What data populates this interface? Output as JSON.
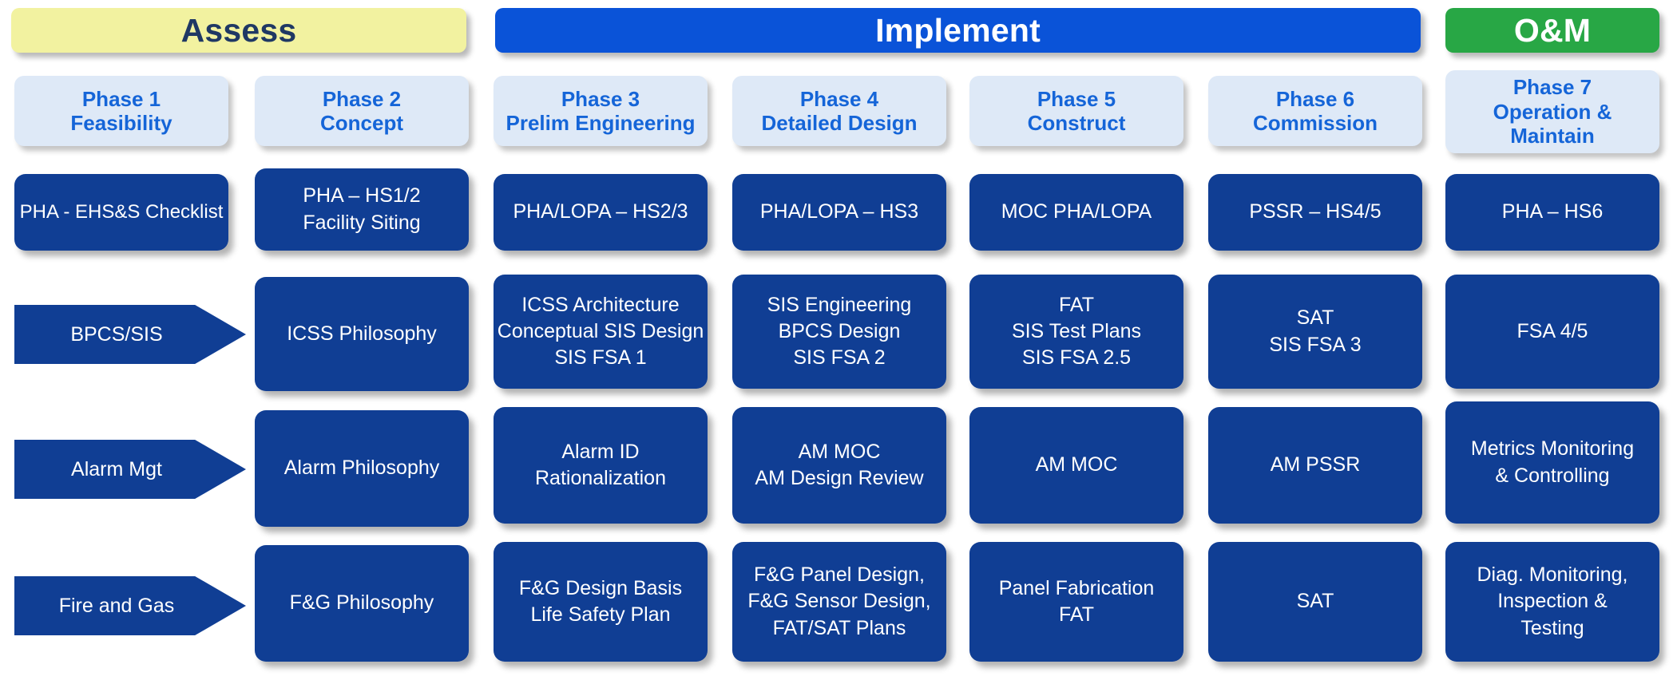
{
  "colors": {
    "assess_banner_bg": "#F2F2A0",
    "assess_banner_text": "#1F3864",
    "implement_banner_bg": "#0A53D8",
    "om_banner_bg": "#28A745",
    "phase_box_bg": "#DEE9F7",
    "phase_box_text": "#1565D8",
    "cell_bg": "#103E94",
    "cell_text": "#FFFFFF"
  },
  "banners": [
    {
      "label": "Assess",
      "id": "assess"
    },
    {
      "label": "Implement",
      "id": "implement"
    },
    {
      "label": "O&M",
      "id": "om"
    }
  ],
  "phases": [
    {
      "number": "Phase 1",
      "name_lines": [
        "Feasibility"
      ]
    },
    {
      "number": "Phase 2",
      "name_lines": [
        "Concept"
      ]
    },
    {
      "number": "Phase 3",
      "name_lines": [
        "Prelim Engineering"
      ]
    },
    {
      "number": "Phase 4",
      "name_lines": [
        "Detailed Design"
      ]
    },
    {
      "number": "Phase 5",
      "name_lines": [
        "Construct"
      ]
    },
    {
      "number": "Phase 6",
      "name_lines": [
        "Commission"
      ]
    },
    {
      "number": "Phase 7",
      "name_lines": [
        "Operation &",
        "Maintain"
      ]
    }
  ],
  "rows": [
    {
      "track_label": "",
      "track_shape": "box",
      "cells": [
        {
          "lines": [
            "PHA - EHS&S Checklist"
          ]
        },
        {
          "lines": [
            "PHA – HS1/2",
            "Facility Siting"
          ]
        },
        {
          "lines": [
            "PHA/LOPA – HS2/3"
          ]
        },
        {
          "lines": [
            "PHA/LOPA – HS3"
          ]
        },
        {
          "lines": [
            "MOC PHA/LOPA"
          ]
        },
        {
          "lines": [
            "PSSR – HS4/5"
          ]
        },
        {
          "lines": [
            "PHA – HS6"
          ]
        }
      ]
    },
    {
      "track_label": "BPCS/SIS",
      "track_shape": "chevron",
      "cells": [
        {
          "lines": [
            "ICSS Philosophy"
          ]
        },
        {
          "lines": [
            "ICSS Architecture",
            "Conceptual SIS Design",
            "SIS FSA 1"
          ]
        },
        {
          "lines": [
            "SIS Engineering",
            "BPCS Design",
            "SIS FSA 2"
          ]
        },
        {
          "lines": [
            "FAT",
            "SIS Test Plans",
            "SIS FSA 2.5"
          ]
        },
        {
          "lines": [
            "SAT",
            "SIS FSA 3"
          ]
        },
        {
          "lines": [
            "FSA 4/5"
          ]
        }
      ]
    },
    {
      "track_label": "Alarm Mgt",
      "track_shape": "chevron",
      "cells": [
        {
          "lines": [
            "Alarm Philosophy"
          ]
        },
        {
          "lines": [
            "Alarm ID",
            "Rationalization"
          ]
        },
        {
          "lines": [
            "AM MOC",
            "AM Design Review"
          ]
        },
        {
          "lines": [
            "AM MOC"
          ]
        },
        {
          "lines": [
            "AM PSSR"
          ]
        },
        {
          "lines": [
            "Metrics Monitoring",
            "& Controlling"
          ]
        }
      ]
    },
    {
      "track_label": "Fire and Gas",
      "track_shape": "chevron",
      "cells": [
        {
          "lines": [
            "F&G Philosophy"
          ]
        },
        {
          "lines": [
            "F&G Design Basis",
            "Life Safety Plan"
          ]
        },
        {
          "lines": [
            "F&G Panel Design,",
            "F&G Sensor Design,",
            "FAT/SAT Plans"
          ]
        },
        {
          "lines": [
            "Panel Fabrication",
            "FAT"
          ]
        },
        {
          "lines": [
            "SAT"
          ]
        },
        {
          "lines": [
            "Diag. Monitoring,",
            "Inspection &",
            "Testing"
          ]
        }
      ]
    }
  ]
}
